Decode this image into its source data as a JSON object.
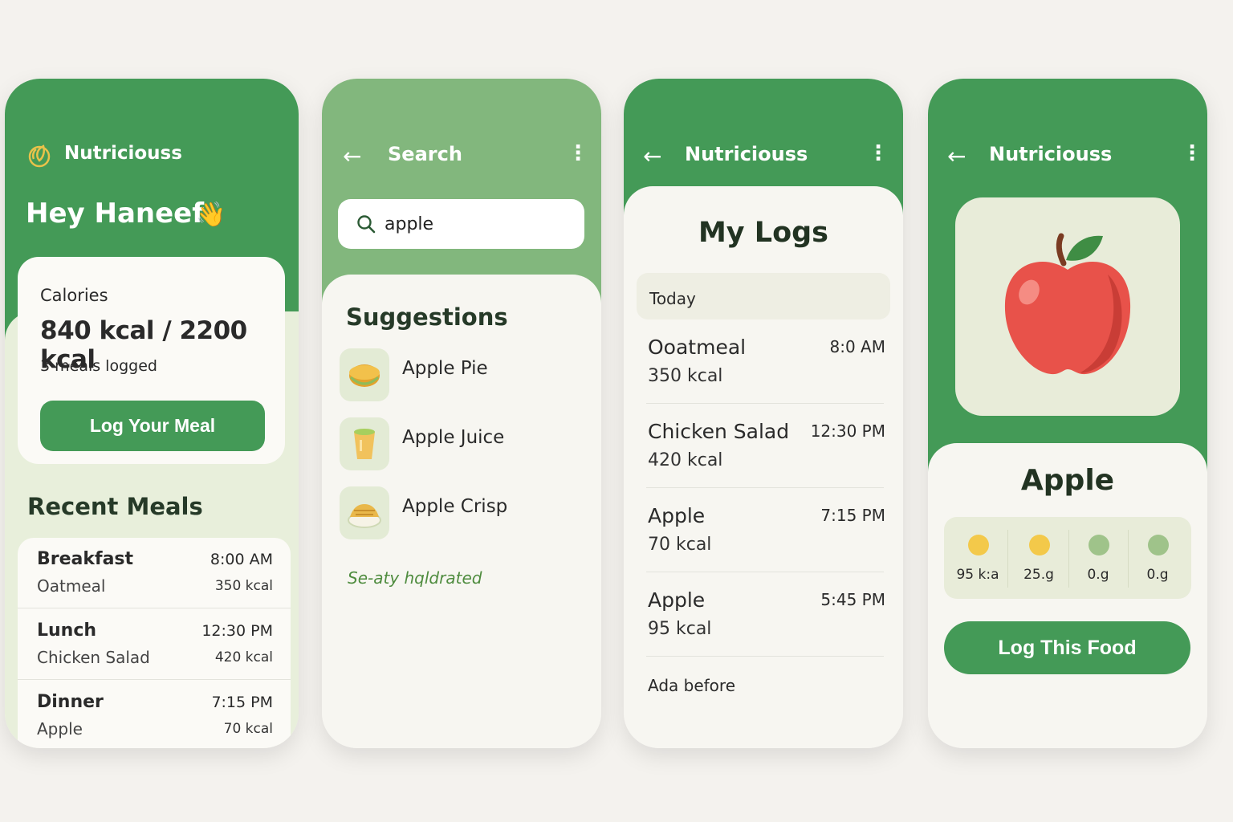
{
  "dashboard": {
    "brand": "Nutriciouss",
    "greeting": "Hey Haneef",
    "wave_emoji": "👋",
    "calories_label": "Calories",
    "calories_value": "840  kcal / 2200 kcal",
    "meals_logged": "3 meals logged",
    "log_button": "Log Your Meal",
    "recent_title": "Recent Meals",
    "recent_meals": [
      {
        "meal": "Breakfast",
        "food": "Oatmeal",
        "time": "8:00 AM",
        "kcal": "350 kcal"
      },
      {
        "meal": "Lunch",
        "food": "Chicken Salad",
        "time": "12:30 PM",
        "kcal": "420 kcal"
      },
      {
        "meal": "Dinner",
        "food": "Apple",
        "time": "7:15 PM",
        "kcal": "70 kcal"
      }
    ]
  },
  "search": {
    "title": "Search",
    "query": "apple",
    "suggestions_title": "Suggestions",
    "suggestions": [
      {
        "label": "Apple Pie",
        "icon": "pie-icon"
      },
      {
        "label": "Apple Juice",
        "icon": "juice-cup-icon"
      },
      {
        "label": "Apple Crisp",
        "icon": "crisp-bowl-icon"
      }
    ],
    "footnote": "Se-aty hqldrated"
  },
  "logs": {
    "brand": "Nutriciouss",
    "heading": "My Logs",
    "section": "Today",
    "entries": [
      {
        "name": "Ooatmeal",
        "kcal": "350 kcal",
        "time": "8:0 AM"
      },
      {
        "name": "Chicken Salad",
        "kcal": "420 kcal",
        "time": "12:30 PM"
      },
      {
        "name": "Apple",
        "kcal": "70 kcal",
        "time": "7:15 PM"
      },
      {
        "name": "Apple",
        "kcal": "95 kcal",
        "time": "5:45 PM"
      }
    ],
    "footer": "Ada before"
  },
  "food": {
    "brand": "Nutriciouss",
    "name": "Apple",
    "image_icon": "apple-icon",
    "stats": [
      {
        "value": "95 k:a",
        "color": "#f3c94a"
      },
      {
        "value": "25.g",
        "color": "#f3c94a"
      },
      {
        "value": "0.g",
        "color": "#9fc38a"
      },
      {
        "value": "0.g",
        "color": "#9fc38a"
      }
    ],
    "log_button": "Log This Food"
  },
  "colors": {
    "primary_green": "#449a57",
    "light_green": "#82b77d",
    "background": "#f4f2ee",
    "card": "#f7f6f1"
  }
}
